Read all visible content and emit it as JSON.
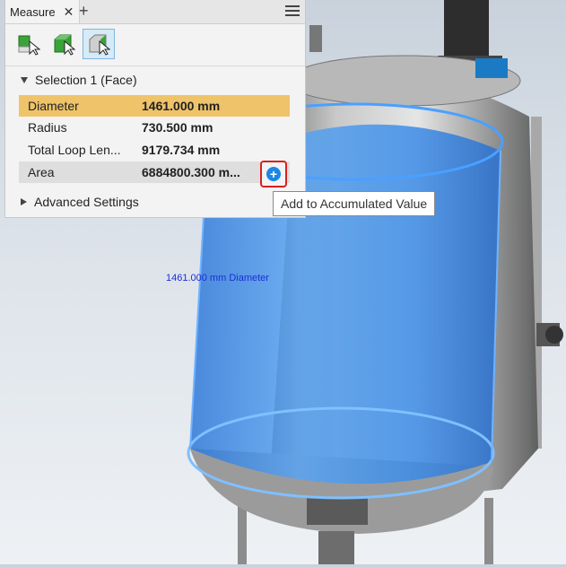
{
  "panel": {
    "tab_label": "Measure",
    "tools": [
      {
        "icon": "measure-distance-icon"
      },
      {
        "icon": "measure-body-icon"
      },
      {
        "icon": "measure-face-icon",
        "selected": true
      }
    ],
    "selection_header": "Selection 1 (Face)",
    "rows": [
      {
        "key": "Diameter",
        "value": "1461.000 mm"
      },
      {
        "key": "Radius",
        "value": "730.500 mm"
      },
      {
        "key": "Total Loop Len...",
        "value": "9179.734 mm"
      },
      {
        "key": "Area",
        "value": "6884800.300 m..."
      }
    ],
    "advanced_label": "Advanced Settings"
  },
  "tooltip": {
    "text": "Add to Accumulated Value"
  },
  "viewport": {
    "dimension_label": "1461.000 mm Diameter"
  },
  "colors": {
    "highlight": "#eec36a",
    "accent": "#1d86e3",
    "tank": "#3b8cf0"
  }
}
